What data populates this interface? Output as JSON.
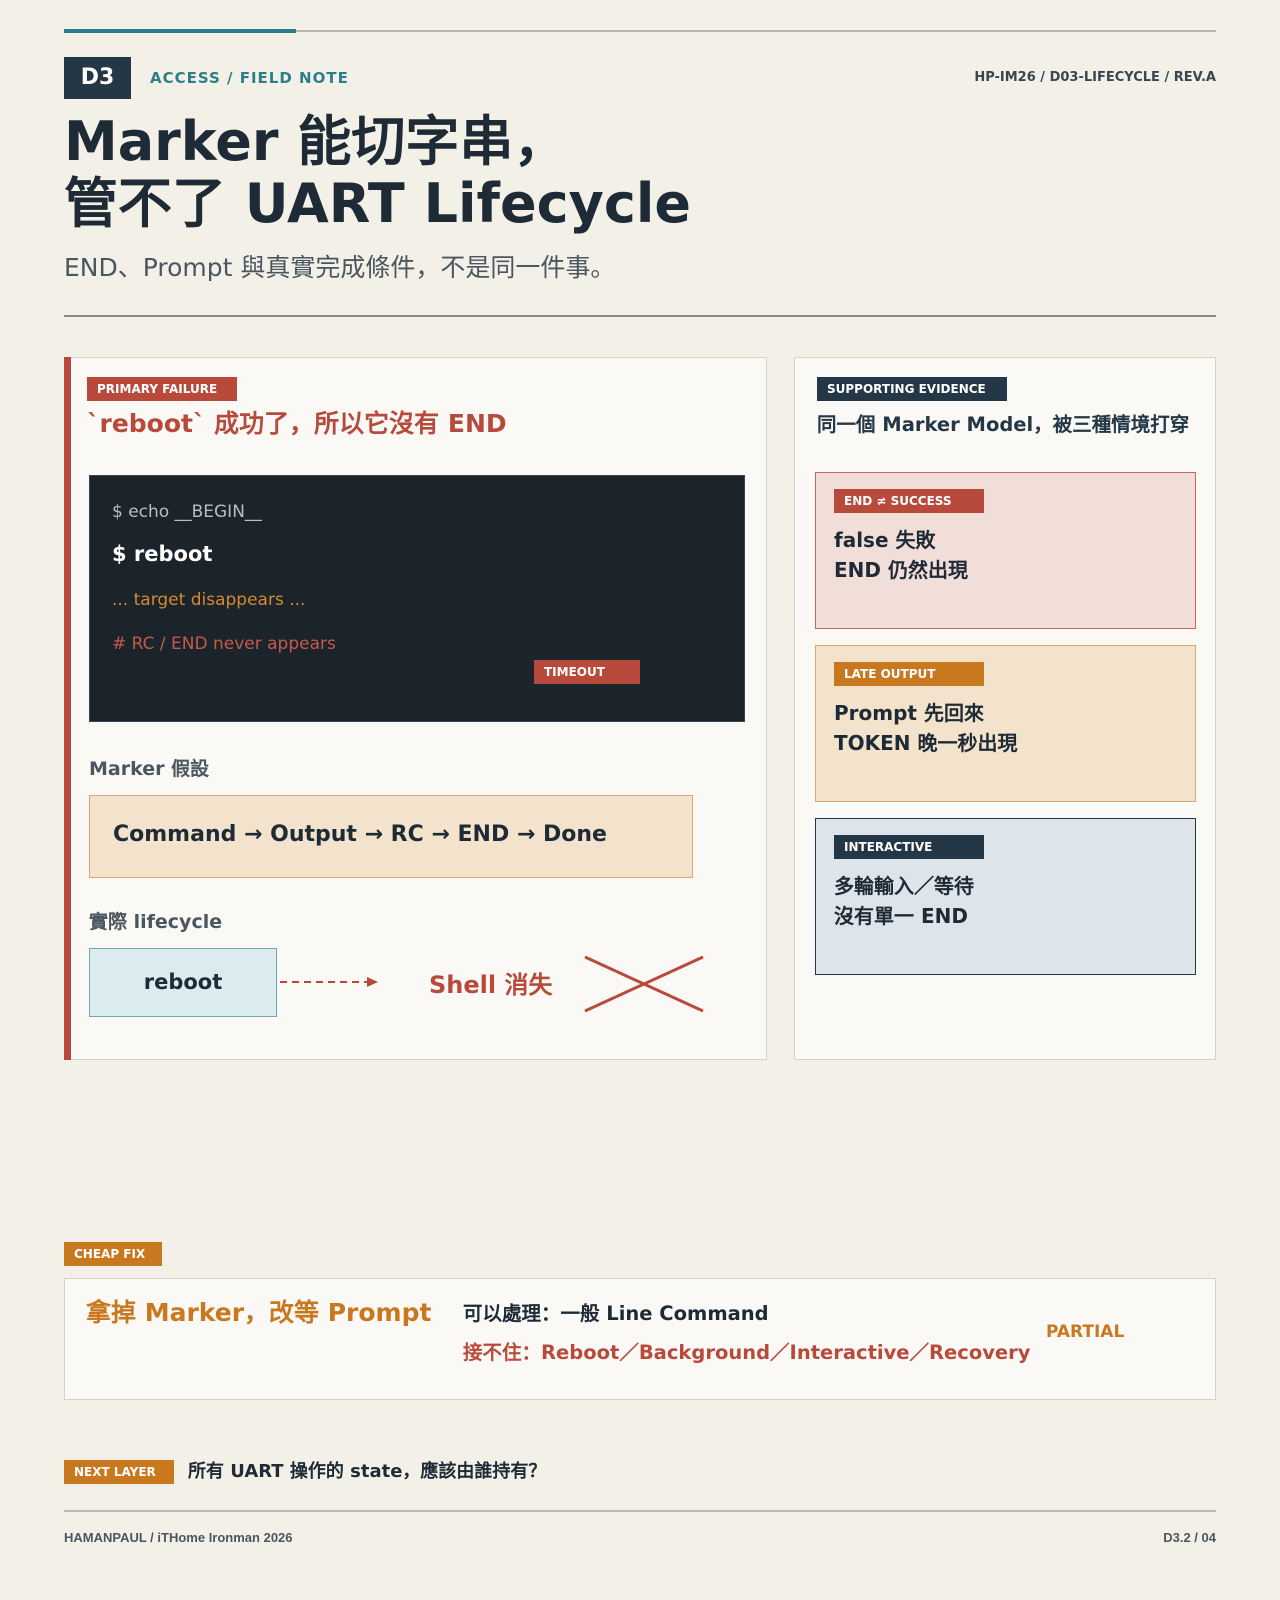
{
  "header": {
    "badge": "D3",
    "category": "ACCESS / FIELD NOTE",
    "doc_ref": "HP-IM26 / D03-LIFECYCLE / REV.A",
    "title_line1": "Marker 能切字串，",
    "title_line2": "管不了 UART Lifecycle",
    "subtitle": "END、Prompt 與真實完成條件，不是同一件事。"
  },
  "primary": {
    "tag": "PRIMARY FAILURE",
    "heading": "`reboot` 成功了，所以它沒有 END",
    "terminal": {
      "line1": "$ echo __BEGIN__",
      "line2": "$ reboot",
      "line3": "... target disappears ...",
      "line4": "# RC / END never appears",
      "timeout": "TIMEOUT"
    },
    "assumption_label": "Marker 假設",
    "assumption_flow": "Command → Output → RC → END → Done",
    "actual_label": "實際 lifecycle",
    "reboot_box": "reboot",
    "shell_gone": "Shell 消失"
  },
  "supporting": {
    "tag": "SUPPORTING EVIDENCE",
    "heading": "同一個 Marker Model，被三種情境打穿",
    "cards": [
      {
        "tag": "END ≠ SUCCESS",
        "line1": "false 失敗",
        "line2": "END 仍然出現"
      },
      {
        "tag": "LATE OUTPUT",
        "line1": "Prompt 先回來",
        "line2": "TOKEN 晚一秒出現"
      },
      {
        "tag": "INTERACTIVE",
        "line1": "多輪輸入／等待",
        "line2": "沒有單一 END"
      }
    ]
  },
  "cheap_fix": {
    "tag": "CHEAP FIX",
    "title": "拿掉 Marker，改等 Prompt",
    "can_handle": "可以處理：一般 Line Command",
    "cannot_handle": "接不住：Reboot／Background／Interactive／Recovery",
    "status": "PARTIAL"
  },
  "next_layer": {
    "tag": "NEXT LAYER",
    "question": "所有 UART 操作的 state，應該由誰持有？"
  },
  "footer": {
    "left": "HAMANPAUL / iTHome Ironman 2026",
    "right": "D3.2 / 04"
  },
  "colors": {
    "teal": "#2c7f8a",
    "navy": "#243746",
    "red": "#b84a3c",
    "orange": "#c8781f",
    "background": "#f3f0e8"
  }
}
